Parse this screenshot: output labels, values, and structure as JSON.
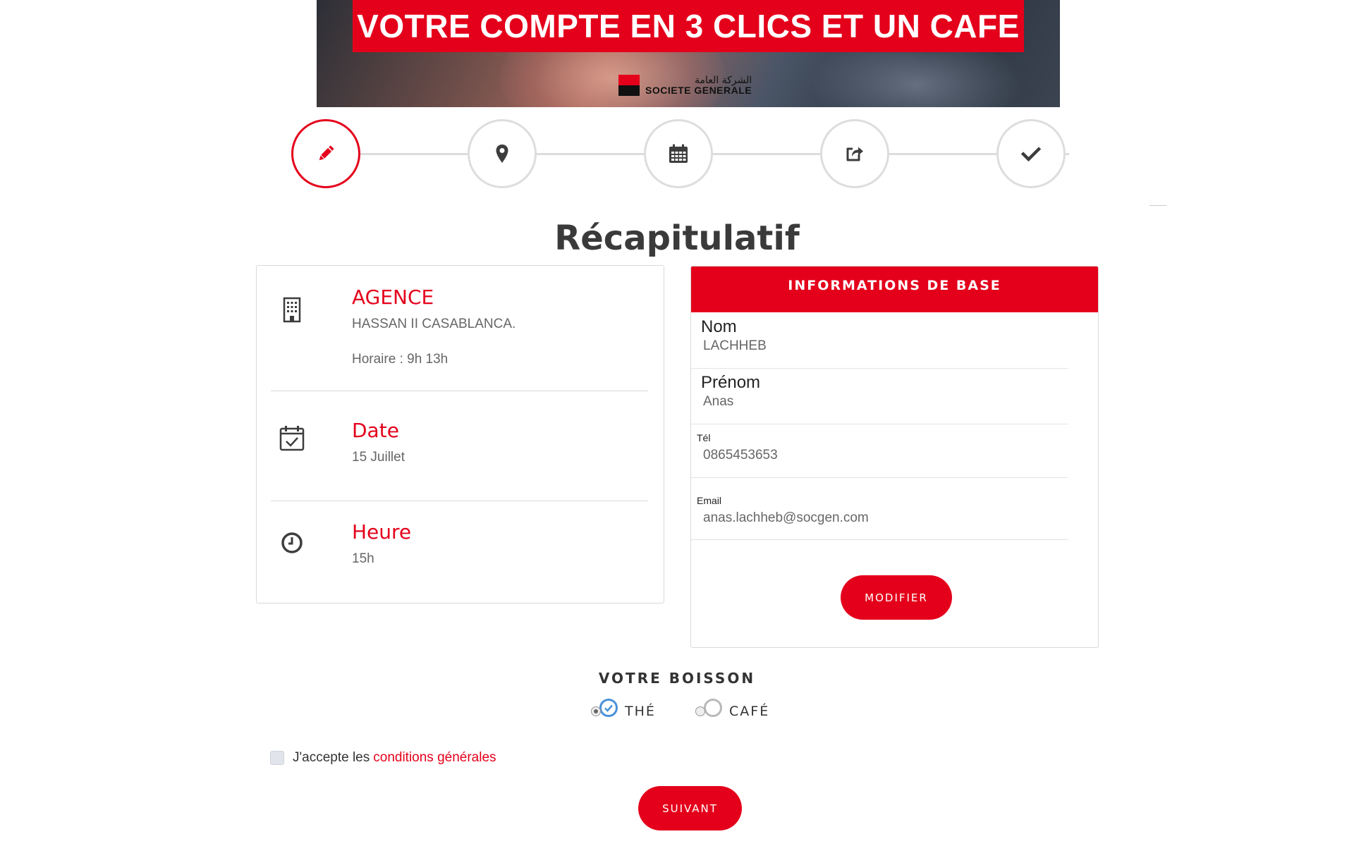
{
  "banner": {
    "headline": "VOTRE COMPTE EN 3 CLICS ET UN CAFE",
    "logo_arabic": "الشركة العامة",
    "logo_name": "SOCIETE GENERALE"
  },
  "stepper": {
    "steps": [
      {
        "icon": "pencil-icon",
        "state": "active"
      },
      {
        "icon": "map-marker-icon",
        "state": "inactive"
      },
      {
        "icon": "calendar-icon",
        "state": "inactive"
      },
      {
        "icon": "share-icon",
        "state": "inactive"
      },
      {
        "icon": "checkmark-icon",
        "state": "inactive"
      }
    ]
  },
  "page": {
    "title": "Récapitulatif"
  },
  "summary": {
    "agence": {
      "heading": "AGENCE",
      "name": "HASSAN II CASABLANCA.",
      "hours": "Horaire : 9h 13h",
      "icon": "building-icon"
    },
    "date": {
      "heading": "Date",
      "value": "15 Juillet",
      "icon": "calendar-check-icon"
    },
    "heure": {
      "heading": "Heure",
      "value": "15h",
      "icon": "clock-icon"
    }
  },
  "info": {
    "header": "INFORMATIONS DE BASE",
    "nom": {
      "label": "Nom",
      "value": "LACHHEB"
    },
    "prenom": {
      "label": "Prénom",
      "value": "Anas"
    },
    "tel": {
      "label": "Tél",
      "value": "0865453653"
    },
    "email": {
      "label": "Email",
      "value": "anas.lachheb@socgen.com"
    },
    "modify_label": "MODIFIER"
  },
  "drink": {
    "title": "VOTRE BOISSON",
    "options": [
      {
        "label": "THÉ",
        "selected": true
      },
      {
        "label": "CAFÉ",
        "selected": false
      }
    ]
  },
  "terms": {
    "prefix": "J'accepte les",
    "link": "conditions générales",
    "checked": false
  },
  "next_label": "SUIVANT",
  "colors": {
    "brand": "#e4001b",
    "radio_selected": "#4a90d9"
  }
}
